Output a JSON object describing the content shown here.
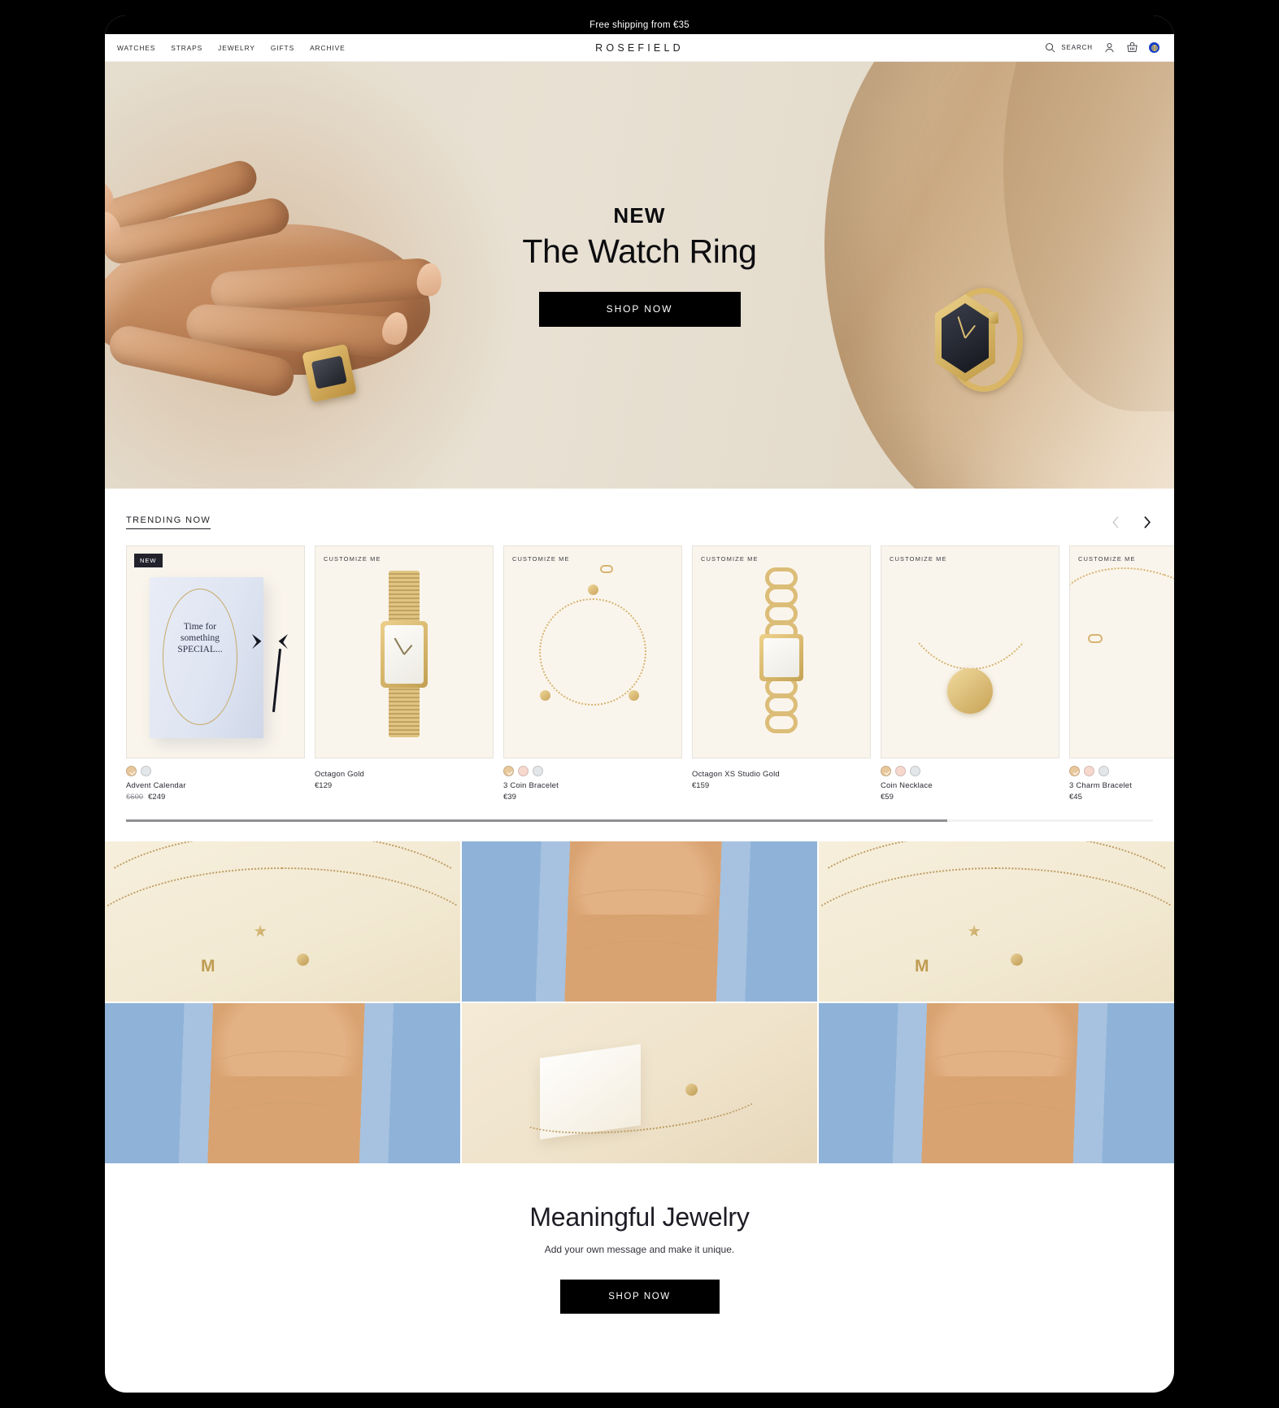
{
  "announcement": {
    "text": "Free shipping from €35"
  },
  "header": {
    "logo": "ROSEFIELD",
    "nav": [
      {
        "label": "WATCHES"
      },
      {
        "label": "STRAPS"
      },
      {
        "label": "JEWELRY"
      },
      {
        "label": "GIFTS"
      },
      {
        "label": "ARCHIVE"
      }
    ],
    "search_label": "SEARCH",
    "icons": {
      "search": "search-icon",
      "account": "account-icon",
      "basket": "basket-icon",
      "locale": "locale-globe-icon"
    },
    "locale_color": "#173fc4"
  },
  "hero": {
    "eyebrow": "NEW",
    "title": "The Watch Ring",
    "cta": "SHOP NOW",
    "background_color": "#e6dfd0",
    "cta_background": "#000000"
  },
  "trending": {
    "title": "TRENDING NOW",
    "prev_arrow": "chevron-left-icon",
    "next_arrow": "chevron-right-icon",
    "prev_disabled": true,
    "progress_percent": 80,
    "products": [
      {
        "badge": "NEW",
        "badge_type": "new",
        "name": "Advent Calendar",
        "price": "€249",
        "price_old": "€600",
        "swatches": [
          "gold",
          "silver"
        ],
        "selected_swatch": 0,
        "art": "advent",
        "box_text_line1": "Time for",
        "box_text_line2": "something",
        "box_text_line3": "SPECIAL..."
      },
      {
        "badge": "CUSTOMIZE ME",
        "badge_type": "customize",
        "name": "Octagon Gold",
        "price": "€129",
        "price_old": "",
        "swatches": [],
        "selected_swatch": -1,
        "art": "watch"
      },
      {
        "badge": "CUSTOMIZE ME",
        "badge_type": "customize",
        "name": "3 Coin Bracelet",
        "price": "€39",
        "price_old": "",
        "swatches": [
          "gold",
          "rose",
          "silver"
        ],
        "selected_swatch": 0,
        "art": "chain"
      },
      {
        "badge": "CUSTOMIZE ME",
        "badge_type": "customize",
        "name": "Octagon XS Studio Gold",
        "price": "€159",
        "price_old": "",
        "swatches": [],
        "selected_swatch": -1,
        "art": "curbwatch"
      },
      {
        "badge": "CUSTOMIZE ME",
        "badge_type": "customize",
        "name": "Coin Necklace",
        "price": "€59",
        "price_old": "",
        "swatches": [
          "gold",
          "rose",
          "silver"
        ],
        "selected_swatch": 0,
        "art": "necklace"
      },
      {
        "badge": "CUSTOMIZE ME",
        "badge_type": "customize",
        "name": "3 Charm Bracelet",
        "price": "€45",
        "price_old": "",
        "swatches": [
          "gold",
          "rose",
          "silver"
        ],
        "selected_swatch": 0,
        "art": "charm"
      }
    ]
  },
  "gallery": {
    "tiles": [
      {
        "kind": "flat-chain-star-m"
      },
      {
        "kind": "model-layered-necklaces"
      },
      {
        "kind": "flat-chain-star-m"
      },
      {
        "kind": "model-layered-necklaces"
      },
      {
        "kind": "bracelet-on-box"
      },
      {
        "kind": "model-layered-necklaces"
      }
    ]
  },
  "meaningful": {
    "title": "Meaningful Jewelry",
    "subtitle": "Add your own message and make it unique.",
    "cta": "SHOP NOW"
  }
}
